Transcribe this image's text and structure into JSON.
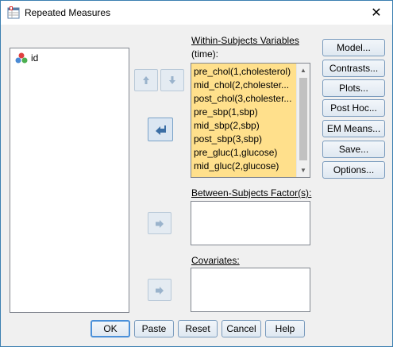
{
  "window": {
    "title": "Repeated Measures"
  },
  "source_list": {
    "items": [
      {
        "label": "id",
        "icon": "nominal-variable-icon"
      }
    ]
  },
  "within": {
    "label_line1": "Within-Subjects Variables",
    "label_line2": "(time):",
    "items": [
      "pre_chol(1,cholesterol)",
      "mid_chol(2,cholester...",
      "post_chol(3,cholester...",
      "pre_sbp(1,sbp)",
      "mid_sbp(2,sbp)",
      "post_sbp(3,sbp)",
      "pre_gluc(1,glucose)",
      "mid_gluc(2,glucose)"
    ]
  },
  "between": {
    "label": "Between-Subjects Factor(s):"
  },
  "covariates": {
    "label": "Covariates:"
  },
  "side_buttons": {
    "model": "Model...",
    "contrasts": "Contrasts...",
    "plots": "Plots...",
    "posthoc": "Post Hoc...",
    "em_means": "EM Means...",
    "save": "Save...",
    "options": "Options..."
  },
  "bottom_buttons": {
    "ok": "OK",
    "paste": "Paste",
    "reset": "Reset",
    "cancel": "Cancel",
    "help": "Help"
  },
  "colors": {
    "selection": "#ffe08c",
    "button_border": "#7a9bbd",
    "arrow_icon": "#9ab3cc",
    "active_arrow_icon": "#3b6ea5"
  }
}
